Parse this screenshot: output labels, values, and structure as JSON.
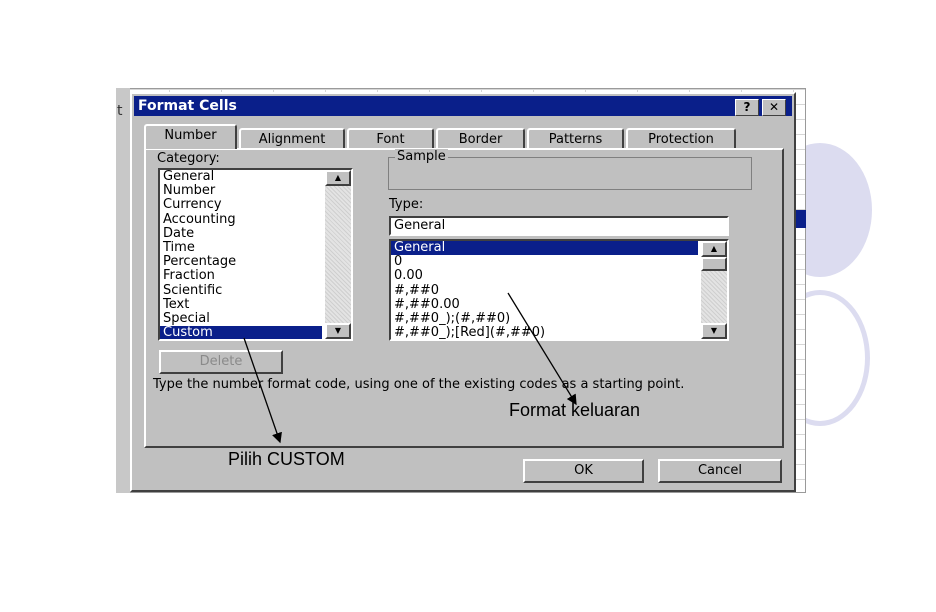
{
  "background": {
    "spreadsheet_partial_text": "t"
  },
  "dialog": {
    "title": "Format Cells",
    "help_button": "?",
    "close_button": "✕",
    "tabs": [
      {
        "label": "Number",
        "active": true
      },
      {
        "label": "Alignment"
      },
      {
        "label": "Font"
      },
      {
        "label": "Border"
      },
      {
        "label": "Patterns"
      },
      {
        "label": "Protection"
      }
    ],
    "category_label": "Category:",
    "categories": [
      "General",
      "Number",
      "Currency",
      "Accounting",
      "Date",
      "Time",
      "Percentage",
      "Fraction",
      "Scientific",
      "Text",
      "Special",
      "Custom"
    ],
    "selected_category": "Custom",
    "sample_label": "Sample",
    "type_label": "Type:",
    "type_value": "General",
    "type_list": [
      "General",
      "0",
      "0.00",
      "#,##0",
      "#,##0.00",
      "#,##0_);(#,##0)",
      "#,##0_);[Red](#,##0)"
    ],
    "selected_type": "General",
    "delete_button": "Delete",
    "description": "Type the number format code, using one of the existing codes as a starting point.",
    "ok_button": "OK",
    "cancel_button": "Cancel"
  },
  "annotations": {
    "custom_note": "Pilih CUSTOM",
    "format_note": "Format keluaran"
  },
  "colors": {
    "titlebar": "#0a1f8a",
    "selection": "#0a1f8a",
    "dialog_face": "#c0c0c0",
    "slide_circle": "#dcdcf0"
  }
}
